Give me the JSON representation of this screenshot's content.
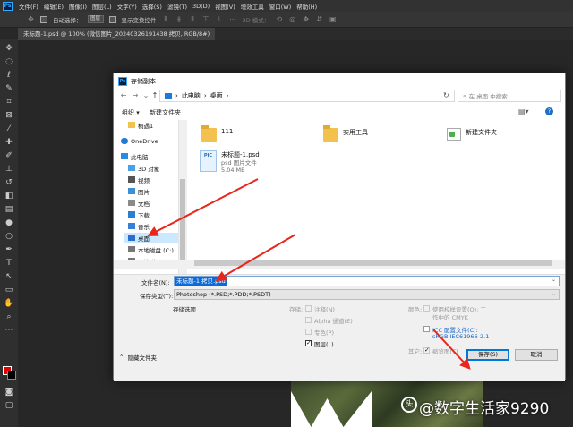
{
  "app": {
    "logo_text": "Ps",
    "menu": [
      "文件(F)",
      "编辑(E)",
      "图像(I)",
      "图层(L)",
      "文字(Y)",
      "选择(S)",
      "滤镜(T)",
      "3D(D)",
      "视图(V)",
      "增效工具",
      "窗口(W)",
      "帮助(H)"
    ],
    "options": {
      "auto_select_label": "自动选择：",
      "auto_select_value": "图层",
      "show_transform_label": "显示变换控件",
      "mode_3d_label": "3D 模式："
    },
    "doc_tab": "未标题-1.psd @ 100% (微信图片_20240326191438 拷贝, RGB/8#)",
    "colors": {
      "foreground": "#e00000",
      "background": "#000000",
      "accent": "#31a8ff"
    }
  },
  "dialog": {
    "title": "存储副本",
    "nav": {
      "back": "←",
      "forward": "→",
      "history": "⌄",
      "up": "↑"
    },
    "breadcrumb": [
      "此电脑",
      "桌面"
    ],
    "search_placeholder": "在 桌面 中搜索",
    "toolbar": {
      "organize": "组织 ▾",
      "new_folder": "新建文件夹"
    },
    "sidebar": [
      {
        "label": "桐遇1"
      },
      {
        "label": "OneDrive"
      },
      {
        "label": "此电脑"
      },
      {
        "label": "3D 对象"
      },
      {
        "label": "视频"
      },
      {
        "label": "图片"
      },
      {
        "label": "文档"
      },
      {
        "label": "下载"
      },
      {
        "label": "音乐"
      },
      {
        "label": "桌面"
      },
      {
        "label": "本地磁盘 (C:)"
      },
      {
        "label": "本地磁盘 (D:)"
      }
    ],
    "files": [
      {
        "name": "111"
      },
      {
        "name": "实用工具"
      },
      {
        "name": "新建文件夹"
      },
      {
        "name": "未标题-1.psd",
        "type": "psd 图片文件",
        "size": "5.04 MB",
        "thumb": "PIC"
      }
    ],
    "form": {
      "filename_label": "文件名(N):",
      "filename_value": "未标题-1 拷贝.psd",
      "filetype_label": "保存类型(T):",
      "filetype_value": "Photoshop (*.PSD;*.PDD;*.PSDT)",
      "save_options_label": "存储选项",
      "save_label": "存储:",
      "annotations": "注释(N)",
      "alpha": "Alpha 通道(E)",
      "spot": "专色(P)",
      "layers": "图层(L)",
      "color_label": "颜色:",
      "proof_setup": "使用校样设置(O): 工",
      "proof_setup_2": "作中的 CMYK",
      "icc_profile": "ICC 配置文件(C):",
      "icc_profile_2": "sRGB IEC61966-2.1",
      "other_label": "其它:",
      "thumbnail": "缩览图(T)",
      "hide_folders": "隐藏文件夹",
      "save_button": "保存(S)",
      "cancel_button": "取消"
    }
  },
  "watermark": {
    "logo": "头",
    "text": "@数字生活家9290"
  }
}
